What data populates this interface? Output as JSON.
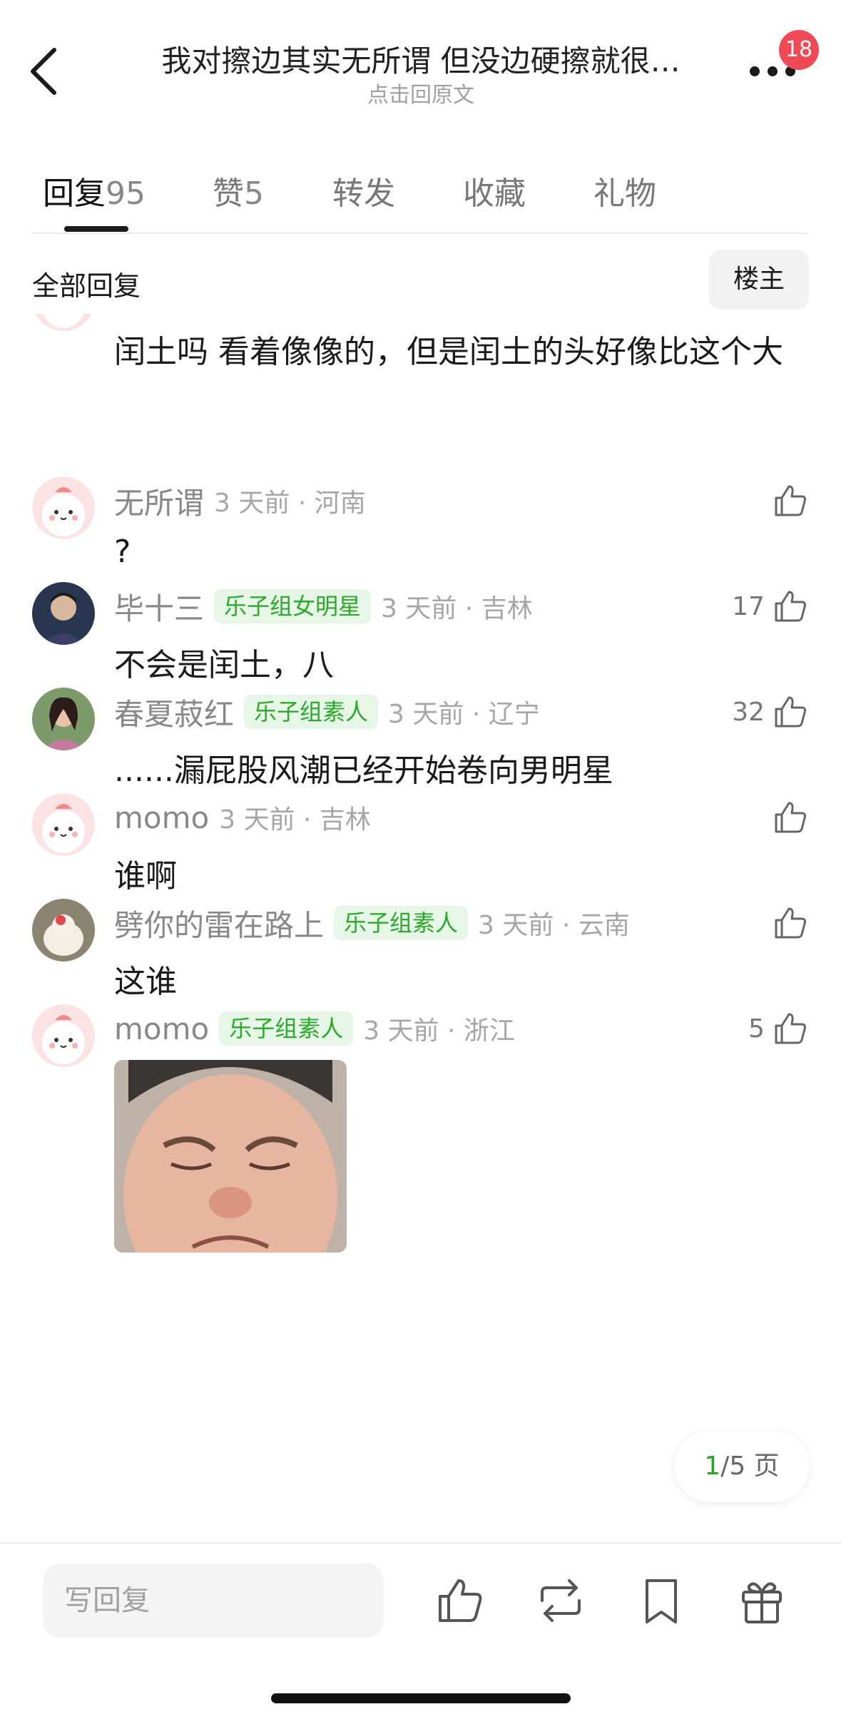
{
  "header": {
    "title": "我对擦边其实无所谓  但没边硬擦就很…",
    "subtitle": "点击回原文",
    "notification_count": "18",
    "back_icon": "chevron-left-icon",
    "more_icon": "more-dots-icon"
  },
  "tabs": [
    {
      "label": "回复",
      "count": "95",
      "active": true
    },
    {
      "label": "赞",
      "count": "5",
      "active": false
    },
    {
      "label": "转发",
      "count": "",
      "active": false
    },
    {
      "label": "收藏",
      "count": "",
      "active": false
    },
    {
      "label": "礼物",
      "count": "",
      "active": false
    }
  ],
  "filter": {
    "label": "全部回复",
    "owner_button": "楼主"
  },
  "continued_comment": {
    "text": "闰土吗 看着像像的，但是闰土的头好像比这个大"
  },
  "comments": [
    {
      "user": "无所谓",
      "tag": "",
      "time": "3 天前 · 河南",
      "likes": "",
      "text": "?"
    },
    {
      "user": "毕十三",
      "tag": "乐子组女明星",
      "time": "3 天前 · 吉林",
      "likes": "17",
      "text": "不会是闰土，八"
    },
    {
      "user": "春夏菽红",
      "tag": "乐子组素人",
      "time": "3 天前 · 辽宁",
      "likes": "32",
      "text": "......漏屁股风潮已经开始卷向男明星"
    },
    {
      "user": "momo",
      "tag": "",
      "time": "3 天前 · 吉林",
      "likes": "",
      "text": "谁啊"
    },
    {
      "user": "劈你的雷在路上",
      "tag": "乐子组素人",
      "time": "3 天前 · 云南",
      "likes": "",
      "text": "这谁"
    },
    {
      "user": "momo",
      "tag": "乐子组素人",
      "time": "3 天前 · 浙江",
      "likes": "5",
      "text": ""
    }
  ],
  "pager": {
    "current": "1",
    "total": "/5 页"
  },
  "bottom_bar": {
    "reply_placeholder": "写回复",
    "icons": [
      "thumbs-up-icon",
      "repost-icon",
      "bookmark-icon",
      "gift-icon"
    ]
  },
  "colors": {
    "accent_green": "#2da82d",
    "badge_red": "#f04a56",
    "tag_bg": "#e7f7e7"
  }
}
